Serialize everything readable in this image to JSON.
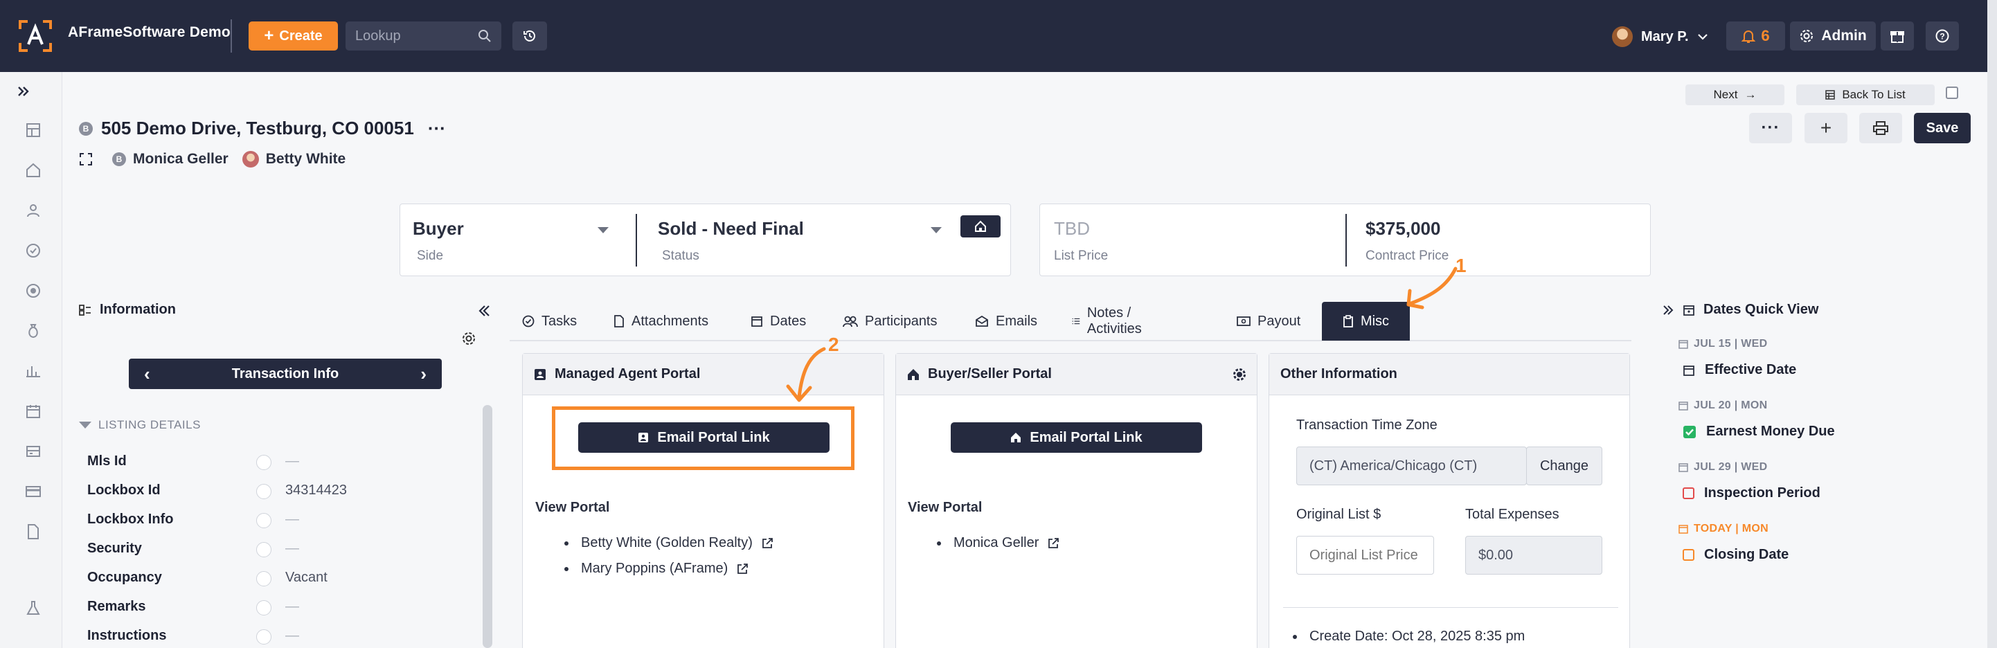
{
  "topbar": {
    "brand": "AFrameSoftware Demo",
    "create_label": "Create",
    "lookup_placeholder": "Lookup",
    "user_name": "Mary P.",
    "notification_count": "6",
    "admin_label": "Admin"
  },
  "nav": {
    "next_label": "Next",
    "back_to_list_label": "Back To List"
  },
  "actions": {
    "save_label": "Save"
  },
  "transaction": {
    "address": "505 Demo Drive, Testburg, CO 00051",
    "people": [
      "Monica Geller",
      "Betty White"
    ]
  },
  "summary": {
    "side": {
      "value": "Buyer",
      "label": "Side"
    },
    "status": {
      "value": "Sold - Need Final",
      "label": "Status"
    },
    "list_price": {
      "value": "TBD",
      "label": "List Price"
    },
    "contract_price": {
      "value": "$375,000",
      "label": "Contract Price"
    }
  },
  "information": {
    "title": "Information",
    "section_nav_label": "Transaction Info",
    "listing_details_label": "LISTING DETAILS",
    "fields": [
      {
        "label": "Mls Id",
        "value": "—"
      },
      {
        "label": "Lockbox Id",
        "value": "34314423"
      },
      {
        "label": "Lockbox Info",
        "value": "—"
      },
      {
        "label": "Security",
        "value": "—"
      },
      {
        "label": "Occupancy",
        "value": "Vacant"
      },
      {
        "label": "Remarks",
        "value": "—"
      },
      {
        "label": "Instructions",
        "value": "—"
      }
    ]
  },
  "tabs": [
    "Tasks",
    "Attachments",
    "Dates",
    "Participants",
    "Emails",
    "Notes / Activities",
    "Payout",
    "Misc"
  ],
  "active_tab": "Misc",
  "managed_agent_portal": {
    "title": "Managed Agent Portal",
    "button_label": "Email Portal Link",
    "view_portal_label": "View Portal",
    "links": [
      "Betty White (Golden Realty)",
      "Mary Poppins (AFrame)"
    ]
  },
  "buyer_seller_portal": {
    "title": "Buyer/Seller Portal",
    "button_label": "Email Portal Link",
    "view_portal_label": "View Portal",
    "links": [
      "Monica Geller"
    ]
  },
  "other_information": {
    "title": "Other Information",
    "time_zone_label": "Transaction Time Zone",
    "time_zone_value": "(CT) America/Chicago (CT)",
    "change_label": "Change",
    "original_list_label": "Original List $",
    "original_list_placeholder": "Original List Price",
    "total_expenses_label": "Total Expenses",
    "total_expenses_value": "$0.00",
    "create_date": "Create Date: Oct 28, 2025 8:35 pm"
  },
  "dates_quick_view": {
    "title": "Dates Quick View",
    "items": [
      {
        "date": "JUL 15 | WED",
        "name": "Effective Date",
        "checked": false,
        "today": false
      },
      {
        "date": "JUL 20 | MON",
        "name": "Earnest Money Due",
        "checked": true,
        "today": false
      },
      {
        "date": "JUL 29 | WED",
        "name": "Inspection Period",
        "checked": false,
        "today": false
      },
      {
        "date": "TODAY | MON",
        "name": "Closing Date",
        "checked": false,
        "today": true
      }
    ]
  },
  "annotations": [
    "1",
    "2"
  ],
  "colors": {
    "navy": "#252a3f",
    "orange": "#f7892b",
    "red_box": "#e24b4b",
    "green_check": "#28b463"
  }
}
